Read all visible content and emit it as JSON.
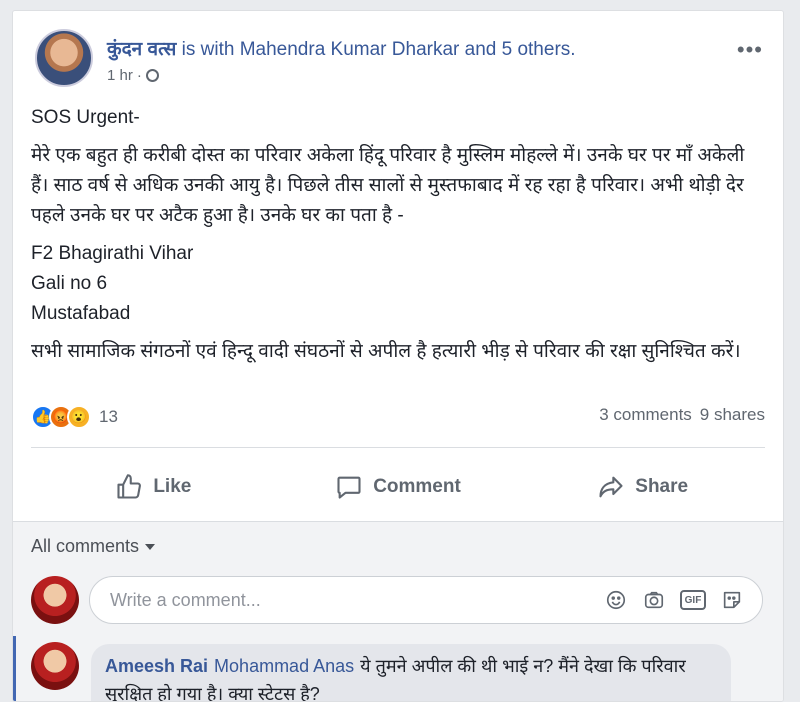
{
  "post": {
    "author": "कुंदन वत्स",
    "with_text": "is with Mahendra Kumar Dharkar and 5 others.",
    "time": "1 hr",
    "lines": [
      "SOS Urgent-",
      "मेरे एक बहुत ही करीबी दोस्त का परिवार अकेला हिंदू परिवार है मुस्लिम मोहल्ले में। उनके घर पर माँ अकेली हैं। साठ वर्ष से अधिक उनकी आयु है। पिछले तीस सालों से मुस्तफाबाद में रह रहा है परिवार। अभी थोड़ी देर पहले उनके घर पर अटैक हुआ है। उनके घर का पता है -"
    ],
    "address": [
      "F2 Bhagirathi Vihar",
      "Gali no 6",
      "Mustafabad"
    ],
    "appeal": "सभी सामाजिक संगठनों एवं हिन्दू वादी संघठनों से अपील है हत्यारी भीड़ से परिवार की रक्षा सुनिश्चित करें।"
  },
  "stats": {
    "reaction_count": "13",
    "comments": "3 comments",
    "shares": "9 shares"
  },
  "actions": {
    "like": "Like",
    "comment": "Comment",
    "share": "Share"
  },
  "comments": {
    "filter": "All comments",
    "placeholder": "Write a comment...",
    "items": [
      {
        "author": "Ameesh Rai",
        "mention": "Mohammad Anas",
        "text": "ये तुमने अपील की थी भाई न? मैंने देखा कि परिवार सुरक्षित हो गया है। क्या स्टेटस है?"
      }
    ]
  },
  "icons": {
    "more": "more-options-icon",
    "globe": "globe-icon",
    "like": "thumbs-up-icon",
    "comment": "speech-bubble-icon",
    "share": "share-arrow-icon",
    "emoji": "smiley-icon",
    "camera": "camera-icon",
    "gif": "GIF",
    "sticker": "sticker-icon"
  },
  "colors": {
    "link": "#385898",
    "like_blue": "#1877f2",
    "text": "#1d2129",
    "muted": "#606770"
  }
}
